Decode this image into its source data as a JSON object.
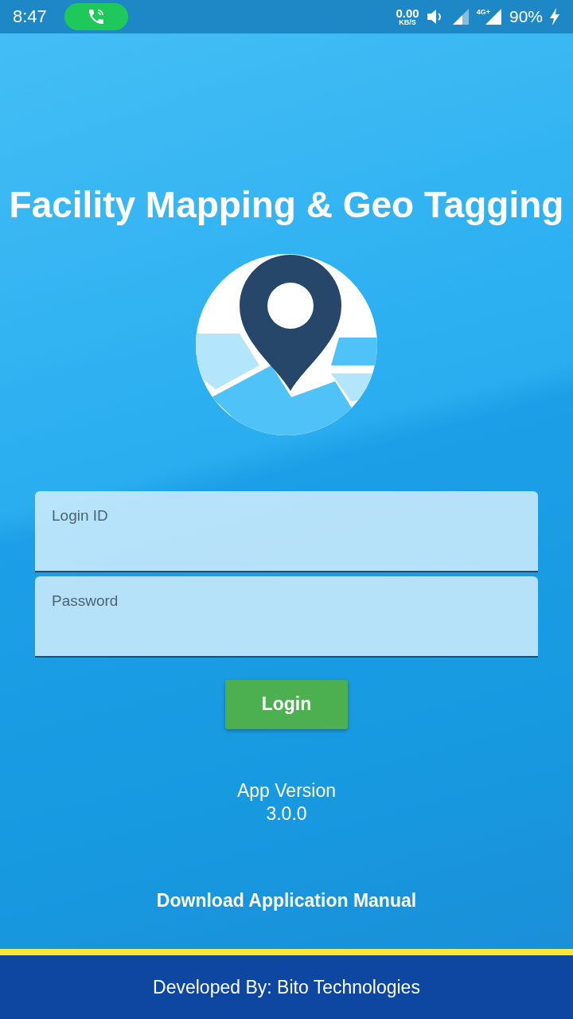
{
  "status_bar": {
    "time": "8:47",
    "speed_value": "0.00",
    "speed_unit": "KB/S",
    "network_type": "4G+",
    "battery": "90%"
  },
  "title": "Facility Mapping & Geo Tagging",
  "fields": [
    {
      "placeholder": "Login ID"
    },
    {
      "placeholder": "Password"
    }
  ],
  "login_button": "Login",
  "version_label": "App Version",
  "version_number": "3.0.0",
  "manual_link": "Download Application Manual",
  "footer": "Developed By: Bito Technologies"
}
